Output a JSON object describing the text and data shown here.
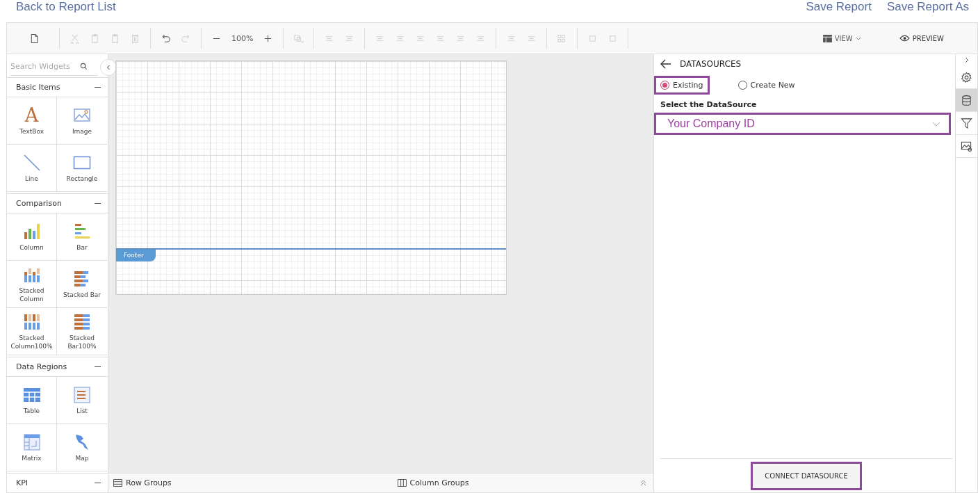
{
  "top_bar": {
    "back_link": "Back to Report List",
    "actions": [
      "Save Report",
      "Save Report As"
    ]
  },
  "toolbar": {
    "groups": [
      [
        {
          "kind": "new",
          "disabled": false
        }
      ],
      [
        {
          "kind": "cut",
          "disabled": true
        },
        {
          "kind": "copy",
          "disabled": true
        },
        {
          "kind": "paste",
          "disabled": true
        },
        {
          "kind": "delete",
          "disabled": true
        }
      ],
      [
        {
          "kind": "undo",
          "disabled": false
        },
        {
          "kind": "redo",
          "disabled": true
        }
      ],
      [
        {
          "kind": "zoom-out",
          "disabled": false
        },
        {
          "kind": "zoom",
          "text": "100%"
        },
        {
          "kind": "zoom-in",
          "disabled": false
        }
      ],
      [
        {
          "kind": "fill",
          "disabled": true
        }
      ],
      [
        {
          "kind": "align",
          "disabled": true
        },
        {
          "kind": "align",
          "disabled": true
        }
      ],
      [
        {
          "kind": "align",
          "disabled": true
        },
        {
          "kind": "align",
          "disabled": true
        },
        {
          "kind": "align",
          "disabled": true
        },
        {
          "kind": "align",
          "disabled": true
        },
        {
          "kind": "align",
          "disabled": true
        },
        {
          "kind": "align",
          "disabled": true
        }
      ],
      [
        {
          "kind": "align",
          "disabled": true
        },
        {
          "kind": "align",
          "disabled": true
        }
      ],
      [
        {
          "kind": "grid",
          "disabled": true
        }
      ],
      [
        {
          "kind": "layer",
          "disabled": true
        },
        {
          "kind": "layer",
          "disabled": true
        }
      ]
    ],
    "view": "VIEW",
    "preview": "PREVIEW"
  },
  "widgets": {
    "search_placeholder": "Search Widgets",
    "sections": [
      {
        "title": "Basic Items",
        "expanded": true,
        "items": [
          {
            "label": "TextBox",
            "kind": "textbox",
            "glyph": "A"
          },
          {
            "label": "Image",
            "kind": "image"
          },
          {
            "label": "Line",
            "kind": "line"
          },
          {
            "label": "Rectangle",
            "kind": "rectangle"
          }
        ]
      },
      {
        "title": "Comparison",
        "expanded": true,
        "items": [
          {
            "label": "Column",
            "kind": "column"
          },
          {
            "label": "Bar",
            "kind": "bar"
          },
          {
            "label": "Stacked Column",
            "kind": "stacked-column"
          },
          {
            "label": "Stacked Bar",
            "kind": "stacked-bar"
          },
          {
            "label": "Stacked Column100%",
            "kind": "column100"
          },
          {
            "label": "Stacked Bar100%",
            "kind": "bar100"
          }
        ]
      },
      {
        "title": "Data Regions",
        "expanded": true,
        "items": [
          {
            "label": "Table",
            "kind": "table"
          },
          {
            "label": "List",
            "kind": "list"
          },
          {
            "label": "Matrix",
            "kind": "matrix"
          },
          {
            "label": "Map",
            "kind": "map"
          }
        ]
      },
      {
        "title": "KPI",
        "expanded": true
      }
    ]
  },
  "canvas": {
    "footer_label": "Footer",
    "row_groups": "Row Groups",
    "column_groups": "Column Groups"
  },
  "panel": {
    "title": "DATASOURCES",
    "options": [
      {
        "label": "Existing",
        "selected": true,
        "highlighted": true
      },
      {
        "label": "Create New",
        "selected": false,
        "highlighted": false
      }
    ],
    "field_label": "Select the DataSource",
    "select": {
      "value": "Your Company ID",
      "highlighted": true
    },
    "connect_button": {
      "label": "CONNECT DATASOURCE",
      "highlighted": true
    }
  },
  "side_tabs": [
    {
      "kind": "settings",
      "selected": false
    },
    {
      "kind": "database",
      "selected": true
    },
    {
      "kind": "filter",
      "selected": false
    },
    {
      "kind": "image",
      "selected": false
    }
  ]
}
